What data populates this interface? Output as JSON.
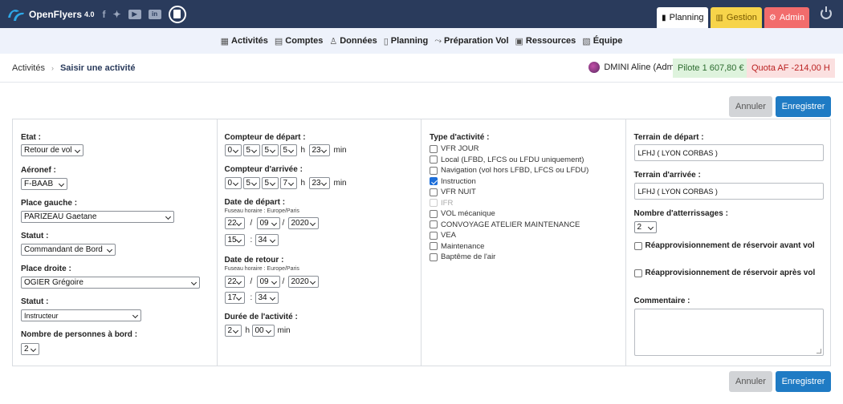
{
  "header": {
    "brand": "OpenFlyers",
    "version": "4.0",
    "tabs": [
      {
        "label": "Planning"
      },
      {
        "label": "Gestion"
      },
      {
        "label": "Admin"
      }
    ]
  },
  "nav": [
    {
      "label": "Activités"
    },
    {
      "label": "Comptes"
    },
    {
      "label": "Données"
    },
    {
      "label": "Planning"
    },
    {
      "label": "Préparation Vol"
    },
    {
      "label": "Ressources"
    },
    {
      "label": "Équipe"
    }
  ],
  "breadcrumb": {
    "parent": "Activités",
    "current": "Saisir une activité"
  },
  "user": {
    "name": "DMINI Aline (Admin)",
    "pilot": "Pilote 1 607,80 €",
    "quota": "Quota AF -214,00 H"
  },
  "actions": {
    "cancel": "Annuler",
    "save": "Enregistrer"
  },
  "col1": {
    "etat_label": "Etat :",
    "etat": "Retour de vol",
    "aeronef_label": "Aéronef :",
    "aeronef": "F-BAAB",
    "place_gauche_label": "Place gauche :",
    "place_gauche": "PARIZEAU Gaetane",
    "statut1_label": "Statut :",
    "statut1": "Commandant de Bord",
    "place_droite_label": "Place droite :",
    "place_droite": "OGIER Grégoire",
    "statut2_label": "Statut :",
    "statut2": "Instructeur",
    "nb_label": "Nombre de personnes à bord :",
    "nb": "2"
  },
  "col2": {
    "cpt_dep_label": "Compteur de départ :",
    "cpt_dep": [
      "0",
      "5",
      "5",
      "5"
    ],
    "cpt_dep_min": "23",
    "cpt_arr_label": "Compteur d'arrivée :",
    "cpt_arr": [
      "0",
      "5",
      "5",
      "7"
    ],
    "cpt_arr_min": "23",
    "h": "h",
    "min": "min",
    "slash": "/",
    "colon": ":",
    "date_dep_label": "Date de départ :",
    "tz": "Fuseau horaire : Europe/Paris",
    "date_dep": {
      "d": "22",
      "m": "09",
      "y": "2020",
      "hh": "15",
      "mm": "34"
    },
    "date_ret_label": "Date de retour :",
    "date_ret": {
      "d": "22",
      "m": "09",
      "y": "2020",
      "hh": "17",
      "mm": "34"
    },
    "duree_label": "Durée de l'activité :",
    "duree_h": "2",
    "duree_m": "00"
  },
  "col3": {
    "label": "Type d'activité :",
    "items": [
      {
        "label": "VFR JOUR",
        "checked": false,
        "disabled": false
      },
      {
        "label": "Local (LFBD, LFCS ou LFDU uniquement)",
        "checked": false,
        "disabled": false
      },
      {
        "label": "Navigation (vol hors LFBD, LFCS ou LFDU)",
        "checked": false,
        "disabled": false
      },
      {
        "label": "Instruction",
        "checked": true,
        "disabled": false
      },
      {
        "label": "VFR NUIT",
        "checked": false,
        "disabled": false
      },
      {
        "label": "IFR",
        "checked": false,
        "disabled": true
      },
      {
        "label": "VOL mécanique",
        "checked": false,
        "disabled": false
      },
      {
        "label": "CONVOYAGE ATELIER MAINTENANCE",
        "checked": false,
        "disabled": false
      },
      {
        "label": "VEA",
        "checked": false,
        "disabled": false
      },
      {
        "label": "Maintenance",
        "checked": false,
        "disabled": false
      },
      {
        "label": "Baptême de l'air",
        "checked": false,
        "disabled": false
      }
    ]
  },
  "col4": {
    "terrain_dep_label": "Terrain de départ :",
    "terrain_dep": "LFHJ ( LYON CORBAS )",
    "terrain_arr_label": "Terrain d'arrivée :",
    "terrain_arr": "LFHJ ( LYON CORBAS )",
    "att_label": "Nombre d'atterrissages :",
    "att": "2",
    "reappro_avant": "Réapprovisionnement de réservoir avant vol",
    "reappro_apres": "Réapprovisionnement de réservoir après vol",
    "comment_label": "Commentaire :"
  }
}
